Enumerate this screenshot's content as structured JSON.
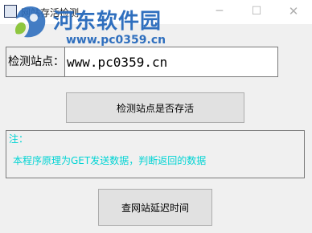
{
  "window": {
    "title": "网站存活检测",
    "minimize_glyph": "─",
    "maximize_glyph": "☐",
    "close_glyph": "✕"
  },
  "watermark": {
    "name": "河东软件园",
    "url": "www.pc0359.cn"
  },
  "form": {
    "site_label": "检测站点：",
    "site_value": "www.pc0359.cn"
  },
  "buttons": {
    "check": "检测站点是否存活",
    "delay": "查网站延迟时间"
  },
  "note": {
    "title": "注：",
    "text": "本程序原理为GET发送数据，判断返回的数据"
  },
  "colors": {
    "note_text": "#00d4d4",
    "watermark": "#2f6fbe",
    "window_bg": "#f0f0f0"
  },
  "icons": [
    "app-icon",
    "watermark-logo-icon"
  ]
}
